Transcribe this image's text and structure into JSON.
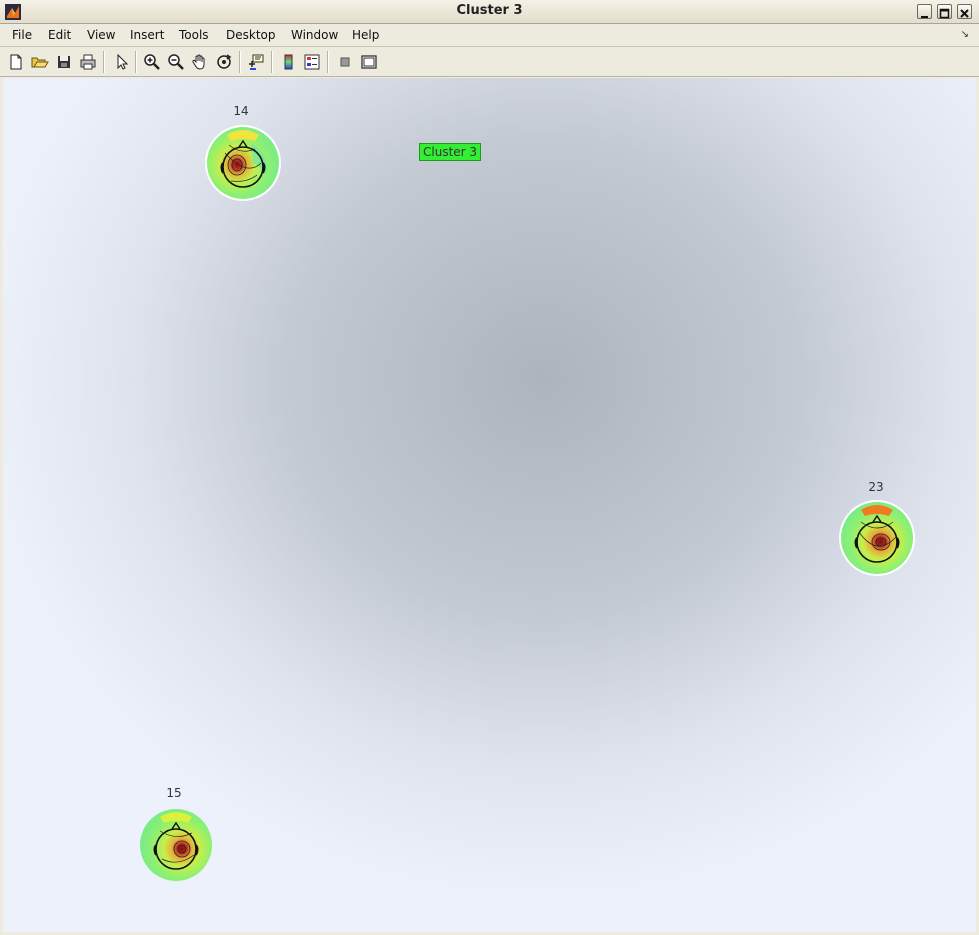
{
  "window": {
    "title": "Cluster 3"
  },
  "menubar": {
    "items": [
      {
        "label": "File"
      },
      {
        "label": "Edit"
      },
      {
        "label": "View"
      },
      {
        "label": "Insert"
      },
      {
        "label": "Tools"
      },
      {
        "label": "Desktop"
      },
      {
        "label": "Window"
      },
      {
        "label": "Help"
      }
    ]
  },
  "toolbar": {
    "tools": [
      "new-file-icon",
      "open-folder-icon",
      "save-icon",
      "print-icon",
      "pointer-icon",
      "zoom-in-icon",
      "zoom-out-icon",
      "pan-hand-icon",
      "rotate-3d-icon",
      "data-cursor-icon",
      "colorbar-icon",
      "legend-icon",
      "hide-plot-tools-icon",
      "show-plot-tools-icon"
    ]
  },
  "figure": {
    "legend_label": "Cluster 3",
    "legend_color": "#33ee33",
    "scalp_maps": [
      {
        "label": "14"
      },
      {
        "label": "23"
      },
      {
        "label": "15"
      }
    ]
  }
}
